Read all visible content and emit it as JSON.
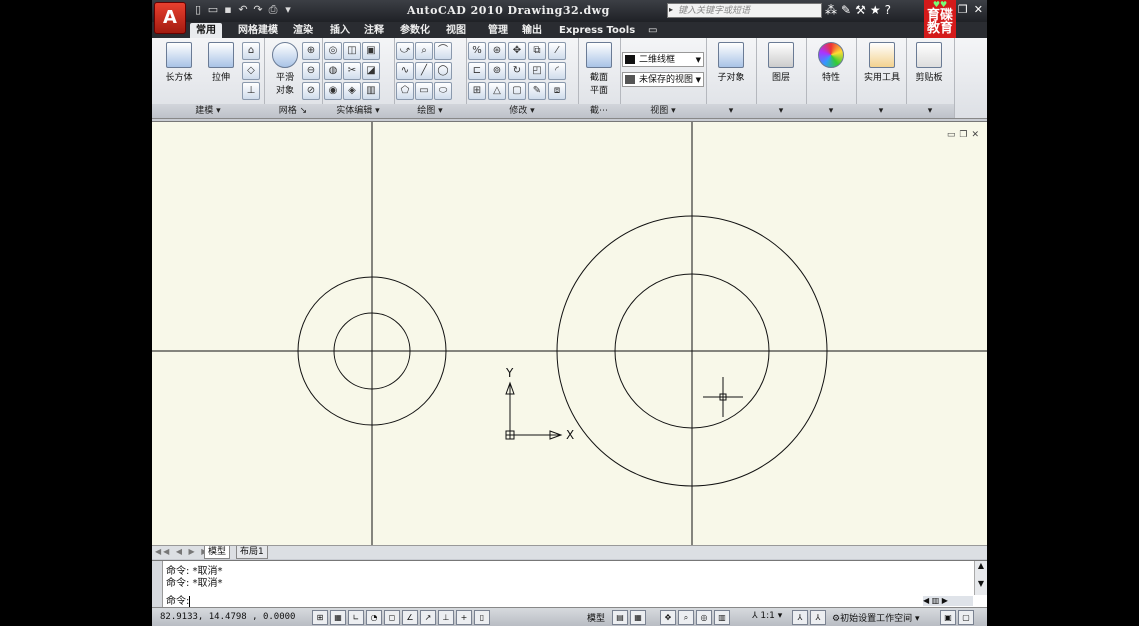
{
  "window": {
    "title": "AutoCAD 2010   Drawing32.dwg",
    "search_placeholder": "键入关键字或短语",
    "brand_top": "育",
    "brand_line2": "碟",
    "brand_line3": "教育"
  },
  "tabs": [
    {
      "label": "常用",
      "active": true
    },
    {
      "label": "网格建模"
    },
    {
      "label": "渲染"
    },
    {
      "label": "插入"
    },
    {
      "label": "注释"
    },
    {
      "label": "参数化"
    },
    {
      "label": "视图"
    },
    {
      "label": "管理"
    },
    {
      "label": "输出"
    },
    {
      "label": "Express Tools"
    }
  ],
  "ribbon": {
    "modeling": {
      "footer": "建模",
      "box": "长方体",
      "extrude": "拉伸"
    },
    "mesh": {
      "footer": "网格",
      "smooth": "平滑",
      "smooth2": "对象"
    },
    "solid_edit": {
      "footer": "实体编辑"
    },
    "draw": {
      "footer": "绘图"
    },
    "modify": {
      "footer": "修改"
    },
    "section": {
      "footer": "截⋯",
      "label": "截面",
      "label2": "平面"
    },
    "view": {
      "footer": "视图",
      "visual_style": "二维线框",
      "saved_view": "未保存的视图"
    },
    "subobject": {
      "label": "子对象"
    },
    "layers": {
      "label": "图层"
    },
    "properties": {
      "label": "特性"
    },
    "utilities": {
      "label": "实用工具"
    },
    "clipboard": {
      "label": "剪贴板"
    }
  },
  "canvas": {
    "bg_color": "#f8f8e9",
    "ucs_x": "X",
    "ucs_y": "Y"
  },
  "layout_tabs": [
    {
      "label": "模型",
      "active": true
    },
    {
      "label": "布局1"
    }
  ],
  "command": {
    "history": [
      "命令: *取消*",
      "命令: *取消*"
    ],
    "prompt": "命令: "
  },
  "status": {
    "coords": "82.9133,  14.4798 , 0.0000",
    "model": "模型",
    "scale": "1:1",
    "workspace": "初始设置工作空间"
  }
}
